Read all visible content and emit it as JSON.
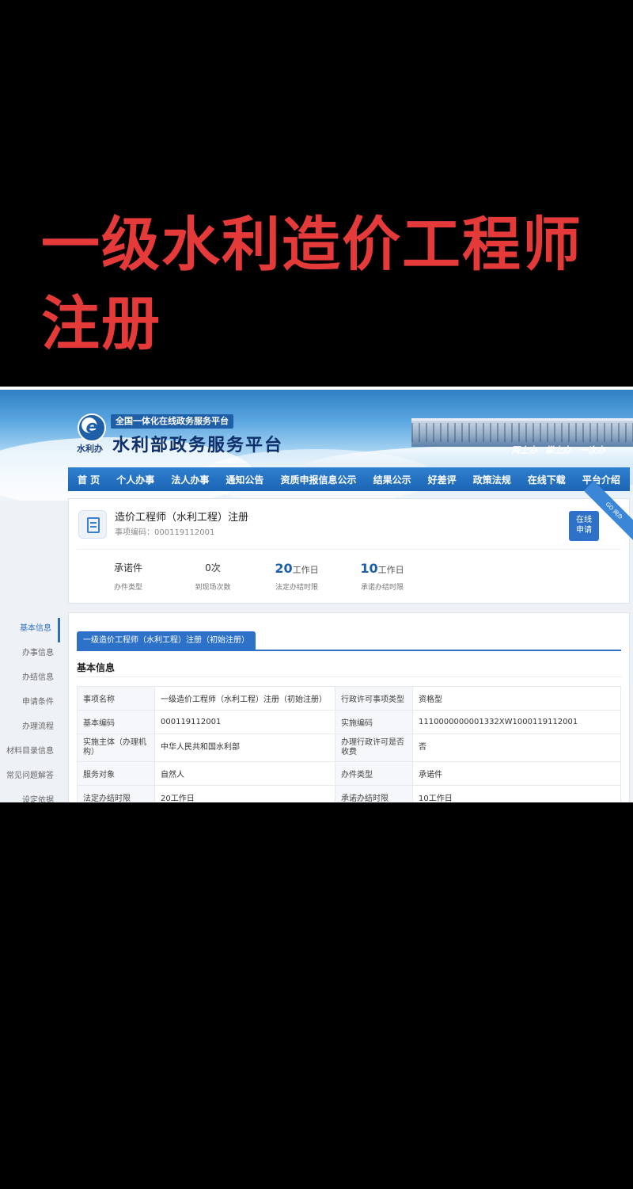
{
  "headline": {
    "line1": "一级水利造价工程师",
    "line2": "注册"
  },
  "header": {
    "logo_letter": "e",
    "logo_sub": "水利办",
    "tag": "全国一体化在线政务服务平台",
    "site_title": "水利部政务服务平台",
    "slogans": [
      "网上办",
      "掌上办",
      "一次办"
    ]
  },
  "nav": {
    "items": [
      "首 页",
      "个人办事",
      "法人办事",
      "通知公告",
      "资质申报信息公示",
      "结果公示",
      "好差评",
      "政策法规",
      "在线下载",
      "平台介绍"
    ]
  },
  "service": {
    "title": "造价工程师（水利工程）注册",
    "code_label": "事项编码：",
    "code": "000119112001",
    "apply_line1": "在线",
    "apply_line2": "申请",
    "corner_tag": "GO 网办",
    "stats": [
      {
        "value": "承诺件",
        "unit": "",
        "label": "办件类型"
      },
      {
        "value": "0次",
        "unit": "",
        "label": "到现场次数"
      },
      {
        "value": "20",
        "unit": "工作日",
        "label": "法定办结时限"
      },
      {
        "value": "10",
        "unit": "工作日",
        "label": "承诺办结时限"
      }
    ]
  },
  "sidenav": {
    "items": [
      "基本信息",
      "办事信息",
      "办结信息",
      "申请条件",
      "办理流程",
      "材料目录信息",
      "常见问题解答",
      "设定依据"
    ],
    "active": 0
  },
  "details": {
    "tab": "一级造价工程师（水利工程）注册（初始注册）",
    "section_title": "基本信息",
    "rows": [
      [
        "事项名称",
        "一级造价工程师（水利工程）注册（初始注册）",
        "行政许可事项类型",
        "资格型"
      ],
      [
        "基本编码",
        "000119112001",
        "实施编码",
        "1110000000001332XW1000119112001"
      ],
      [
        "实施主体（办理机构）",
        "中华人民共和国水利部",
        "办理行政许可是否收费",
        "否"
      ],
      [
        "服务对象",
        "自然人",
        "办件类型",
        "承诺件"
      ],
      [
        "法定办结时限",
        "20工作日",
        "承诺办结时限",
        "10工作日"
      ]
    ]
  },
  "colors": {
    "accent": "#2d72c8",
    "headline": "#e53a3a",
    "nav": "#1c64b4"
  }
}
